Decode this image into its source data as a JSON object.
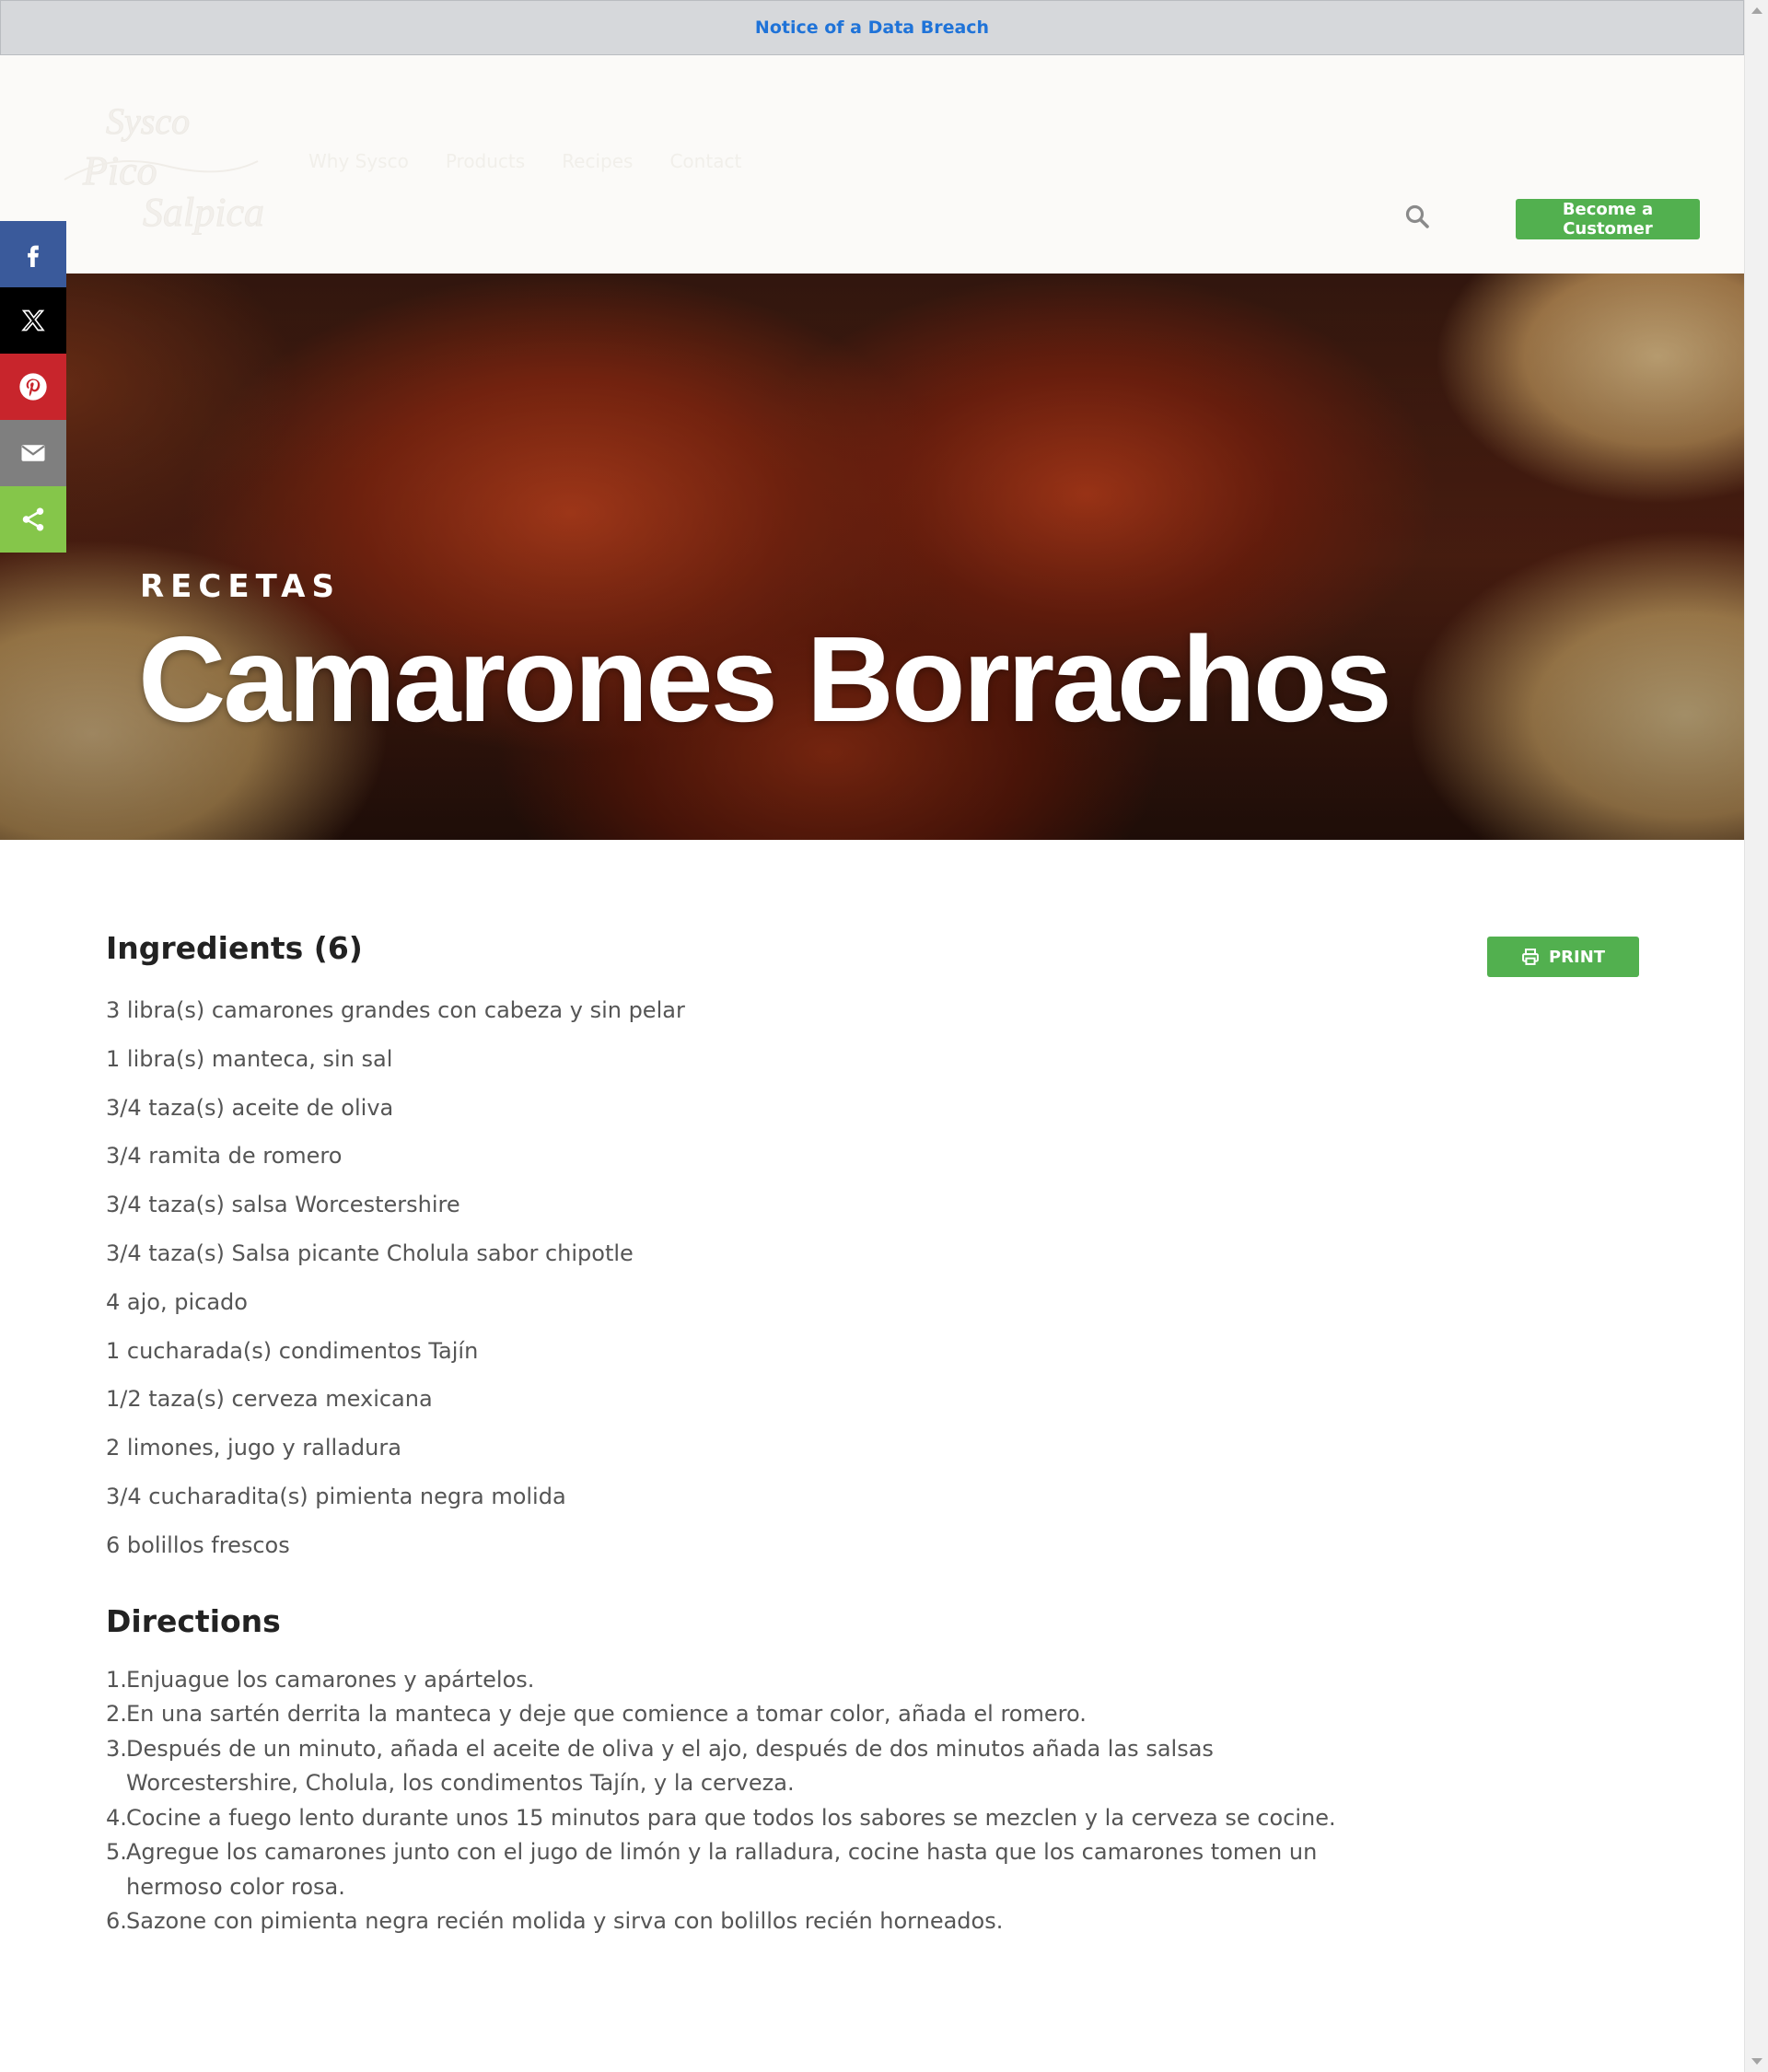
{
  "notice": {
    "link_text": "Notice of a Data Breach"
  },
  "header": {
    "logo_text": "Sysco Pico Salpica",
    "nav_items": [
      "Why Sysco",
      "Products",
      "Recipes",
      "Contact"
    ],
    "search_icon": "search-icon",
    "become_customer_label": "Become a Customer"
  },
  "share": {
    "items": [
      {
        "name": "facebook",
        "icon": "facebook-icon",
        "color": "#3a5a9b"
      },
      {
        "name": "x",
        "icon": "x-icon",
        "color": "#000000"
      },
      {
        "name": "pinterest",
        "icon": "pinterest-icon",
        "color": "#c8252c"
      },
      {
        "name": "email",
        "icon": "email-icon",
        "color": "#7f7f7f"
      },
      {
        "name": "sharethis",
        "icon": "share-icon",
        "color": "#85c64a"
      }
    ]
  },
  "hero": {
    "eyebrow": "RECETAS",
    "title": "Camarones Borrachos"
  },
  "recipe": {
    "ingredients_heading": "Ingredients (6)",
    "print_label": "PRINT",
    "ingredients": [
      "3 libra(s) camarones grandes con cabeza y sin pelar",
      "1 libra(s) manteca, sin sal",
      "3/4 taza(s) aceite de oliva",
      "3/4 ramita de romero",
      "3/4 taza(s) salsa Worcestershire",
      "3/4 taza(s) Salsa picante Cholula sabor chipotle",
      "4 ajo, picado",
      "1 cucharada(s) condimentos Tajín",
      "1/2 taza(s) cerveza mexicana",
      "2 limones, jugo y ralladura",
      "3/4 cucharadita(s) pimienta negra molida",
      "6 bolillos frescos"
    ],
    "directions_heading": "Directions",
    "directions": [
      "Enjuague los camarones y apártelos.",
      "En una sartén derrita la manteca y deje que comience a tomar color, añada el romero.",
      "Después de un minuto, añada el aceite de oliva y el ajo, después de dos minutos añada las salsas Worcestershire, Cholula, los condimentos Tajín, y la cerveza.",
      "Cocine a fuego lento durante unos 15 minutos para que todos los sabores se mezclen y la cerveza se cocine.",
      "Agregue los camarones junto con el jugo de limón y la ralladura, cocine hasta que los camarones tomen un hermoso color rosa.",
      "Sazone con pimienta negra recién molida y sirva con bolillos recién horneados."
    ]
  },
  "colors": {
    "accent_green": "#52b04f",
    "notice_link": "#1f73d8",
    "heading": "#222222",
    "body_text": "#555555"
  }
}
